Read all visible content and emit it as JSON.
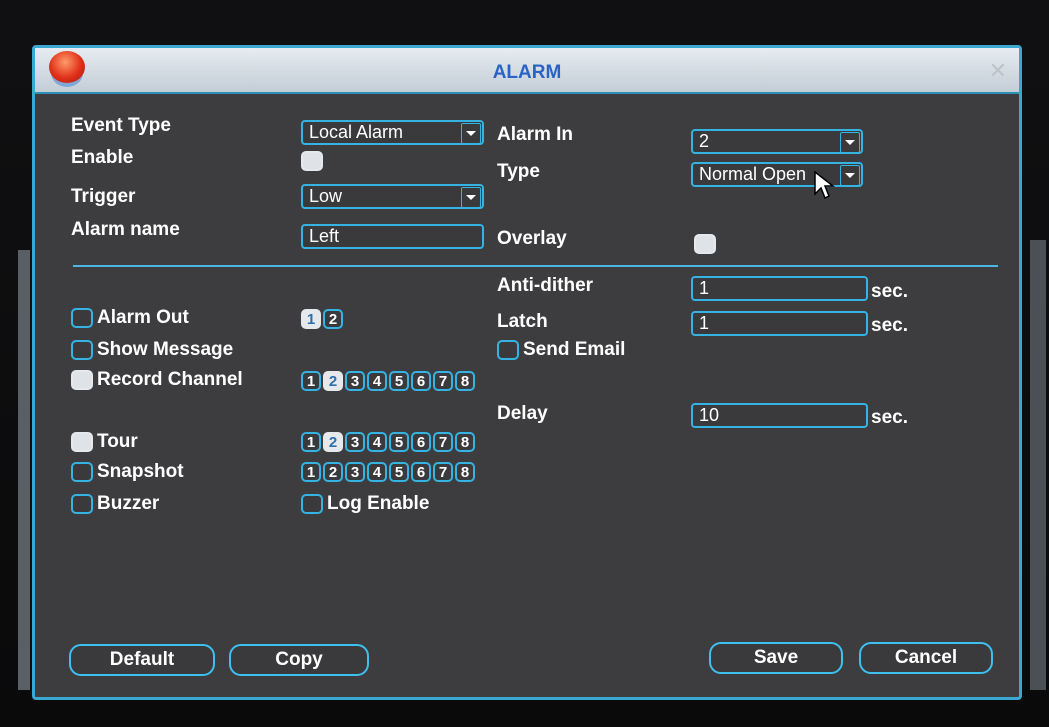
{
  "window": {
    "title": "ALARM",
    "close_icon": "close-icon"
  },
  "form": {
    "event_type": {
      "label": "Event Type",
      "value": "Local Alarm"
    },
    "enable": {
      "label": "Enable",
      "checked": true
    },
    "trigger": {
      "label": "Trigger",
      "value": "Low"
    },
    "alarm_name": {
      "label": "Alarm name",
      "value": "Left"
    },
    "alarm_in": {
      "label": "Alarm In",
      "value": "2"
    },
    "type": {
      "label": "Type",
      "value": "Normal Open"
    },
    "overlay": {
      "label": "Overlay",
      "checked": true
    },
    "anti_dither": {
      "label": "Anti-dither",
      "value": "1",
      "unit": "sec."
    },
    "latch": {
      "label": "Latch",
      "value": "1",
      "unit": "sec."
    },
    "delay": {
      "label": "Delay",
      "value": "10",
      "unit": "sec."
    }
  },
  "options": {
    "alarm_out": {
      "label": "Alarm Out",
      "checked": false,
      "channels": [
        "1",
        "2"
      ],
      "selected": [
        "1"
      ]
    },
    "show_message": {
      "label": "Show Message",
      "checked": false
    },
    "send_email": {
      "label": "Send Email",
      "checked": false
    },
    "record_channel": {
      "label": "Record Channel",
      "checked": true,
      "channels": [
        "1",
        "2",
        "3",
        "4",
        "5",
        "6",
        "7",
        "8"
      ],
      "selected": [
        "2"
      ]
    },
    "tour": {
      "label": "Tour",
      "checked": true,
      "channels": [
        "1",
        "2",
        "3",
        "4",
        "5",
        "6",
        "7",
        "8"
      ],
      "selected": [
        "2"
      ]
    },
    "snapshot": {
      "label": "Snapshot",
      "checked": false,
      "channels": [
        "1",
        "2",
        "3",
        "4",
        "5",
        "6",
        "7",
        "8"
      ],
      "selected": []
    },
    "buzzer": {
      "label": "Buzzer",
      "checked": false
    },
    "log_enable": {
      "label": "Log Enable",
      "checked": false
    }
  },
  "buttons": {
    "default": "Default",
    "copy": "Copy",
    "save": "Save",
    "cancel": "Cancel"
  },
  "colors": {
    "accent": "#35b3e3",
    "title_text": "#2a62c6",
    "panel_bg": "#3d3d3f"
  }
}
